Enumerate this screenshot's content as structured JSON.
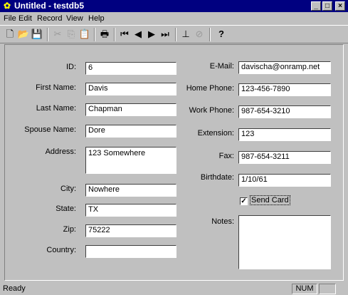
{
  "window": {
    "title": "Untitled - testdb5",
    "minimize": "_",
    "maximize": "□",
    "close": "×"
  },
  "menu": [
    {
      "label": "File"
    },
    {
      "label": "Edit"
    },
    {
      "label": "Record"
    },
    {
      "label": "View"
    },
    {
      "label": "Help"
    }
  ],
  "toolbar": {
    "icons": [
      "new-file-icon",
      "open-folder-icon",
      "save-disk-icon",
      "cut-icon",
      "copy-icon",
      "paste-icon",
      "print-icon",
      "first-record-icon",
      "previous-record-icon",
      "next-record-icon",
      "last-record-icon",
      "add-record-icon",
      "delete-record-icon",
      "help-icon"
    ],
    "glyphs": {
      "new": "🗋",
      "open": "📂",
      "save": "💾",
      "cut": "✂",
      "copy": "⎘",
      "paste": "📋",
      "print": "🖶",
      "first": "⏮",
      "prev": "◀",
      "next": "▶",
      "last": "⏭",
      "add": "⊥",
      "delete": "⊘",
      "help": "?"
    }
  },
  "form": {
    "id_label": "ID:",
    "id_value": "6",
    "first_name_label": "First Name:",
    "first_name_value": "Davis",
    "last_name_label": "Last Name:",
    "last_name_value": "Chapman",
    "spouse_name_label": "Spouse Name:",
    "spouse_name_value": "Dore",
    "address_label": "Address:",
    "address_value": "123 Somewhere",
    "city_label": "City:",
    "city_value": "Nowhere",
    "state_label": "State:",
    "state_value": "TX",
    "zip_label": "Zip:",
    "zip_value": "75222",
    "country_label": "Country:",
    "country_value": "",
    "email_label": "E-Mail:",
    "email_value": "davischa@onramp.net",
    "home_phone_label": "Home Phone:",
    "home_phone_value": "123-456-7890",
    "work_phone_label": "Work Phone:",
    "work_phone_value": "987-654-3210",
    "extension_label": "Extension:",
    "extension_value": "123",
    "fax_label": "Fax:",
    "fax_value": "987-654-3211",
    "birthdate_label": "Birthdate:",
    "birthdate_value": "1/10/61",
    "send_card_label": "Send Card",
    "send_card_checked": true,
    "send_card_mark": "✓",
    "notes_label": "Notes:",
    "notes_value": ""
  },
  "status": {
    "text": "Ready",
    "num": "NUM"
  }
}
